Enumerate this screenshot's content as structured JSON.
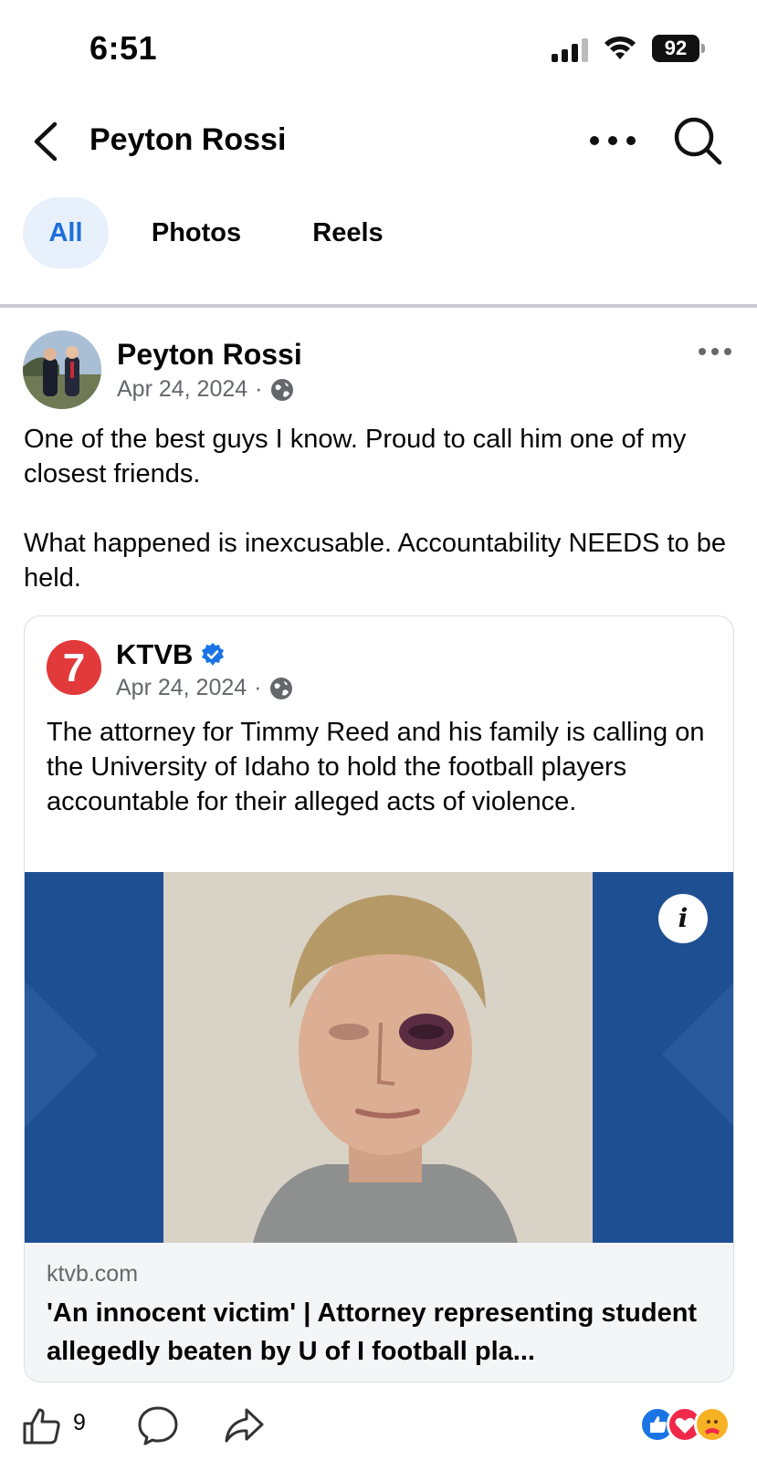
{
  "status_bar": {
    "time": "6:51",
    "battery": "92"
  },
  "header": {
    "title": "Peyton Rossi"
  },
  "tabs": [
    {
      "label": "All",
      "selected": true
    },
    {
      "label": "Photos",
      "selected": false
    },
    {
      "label": "Reels",
      "selected": false
    }
  ],
  "post": {
    "author": "Peyton Rossi",
    "date": "Apr 24, 2024",
    "separator": "·",
    "text": "One of the best guys I know. Proud to call him one of my closest friends.\n\nWhat happened is inexcusable. Accountability NEEDS to be held.",
    "shared": {
      "author": "KTVB",
      "date": "Apr 24, 2024",
      "separator": "·",
      "text": "The attorney for Timmy Reed and his family is calling on the University of Idaho to hold the football players accountable for their alleged acts of violence.",
      "info_glyph": "i",
      "logo_glyph": "7",
      "link": {
        "domain": "ktvb.com",
        "title": "'An innocent victim' | Attorney representing student allegedly beaten by U of I football pla..."
      }
    },
    "like_count": "9"
  },
  "colors": {
    "accent": "#1b6fd8",
    "tab_selected_bg": "#e7f0fb",
    "secondary_text": "#65676b",
    "ktvb_red": "#e2393b",
    "image_blue": "#1f4f93"
  },
  "icons": {
    "back": "chevron-left-icon",
    "more": "ellipsis-icon",
    "search": "search-icon",
    "globe": "globe-icon",
    "verified": "verified-badge-icon",
    "like": "thumbs-up-icon",
    "comment": "comment-bubble-icon",
    "share": "share-arrow-icon"
  }
}
